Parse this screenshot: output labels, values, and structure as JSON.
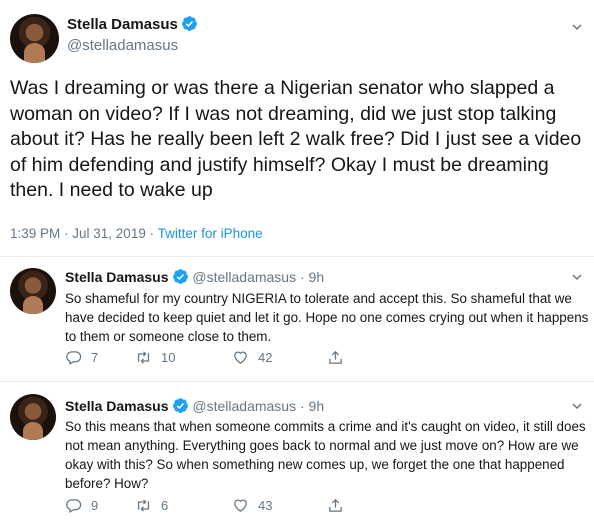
{
  "main_tweet": {
    "author_name": "Stella Damasus",
    "handle": "@stelladamasus",
    "text": "Was I dreaming or was there a Nigerian senator who slapped a woman on video? If I was not dreaming, did we just stop talking about it? Has he really been left 2 walk free? Did I just see a video of him defending and justify himself? Okay I must be dreaming then. I need to wake up",
    "timestamp": "1:39 PM · Jul 31, 2019 · ",
    "source": "Twitter for iPhone",
    "verified_icon": "verified-badge-icon",
    "caret_icon": "chevron-down-icon"
  },
  "replies": [
    {
      "author_name": "Stella Damasus",
      "handle": "@stelladamasus",
      "time": "· 9h",
      "text": "So shameful for my country NIGERIA to tolerate and accept this. So shameful that we have decided to keep quiet and let it go. Hope no one comes crying out when it happens to them or someone close to them.",
      "reply_count": "7",
      "retweet_count": "10",
      "like_count": "42"
    },
    {
      "author_name": "Stella Damasus",
      "handle": "@stelladamasus",
      "time": "· 9h",
      "text": "So this means that when someone commits a crime and it's caught on video, it still does not mean anything. Everything goes back to normal and we just move on? How are we okay with this? So when something new comes up, we forget the one that happened before? How?",
      "reply_count": "9",
      "retweet_count": "6",
      "like_count": "43"
    }
  ],
  "colors": {
    "verified": "#1da1f2",
    "link": "#1b95e0",
    "secondary_text": "#657786",
    "divider": "#e6ecf0"
  }
}
